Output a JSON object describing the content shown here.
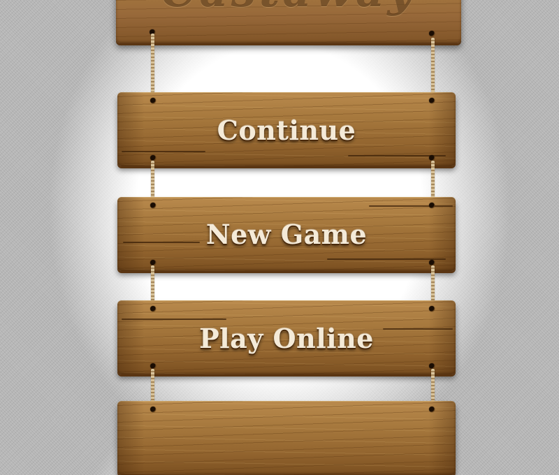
{
  "screen": {
    "title": "Castaway"
  },
  "menu": {
    "items": [
      {
        "label": "Continue"
      },
      {
        "label": "New Game"
      },
      {
        "label": "Play Online"
      },
      {
        "label": ""
      }
    ]
  },
  "colors": {
    "wood_light": "#b98a4d",
    "wood_dark": "#7a4f20",
    "label_text": "#f4ead8",
    "rope": "#d9c39a"
  }
}
